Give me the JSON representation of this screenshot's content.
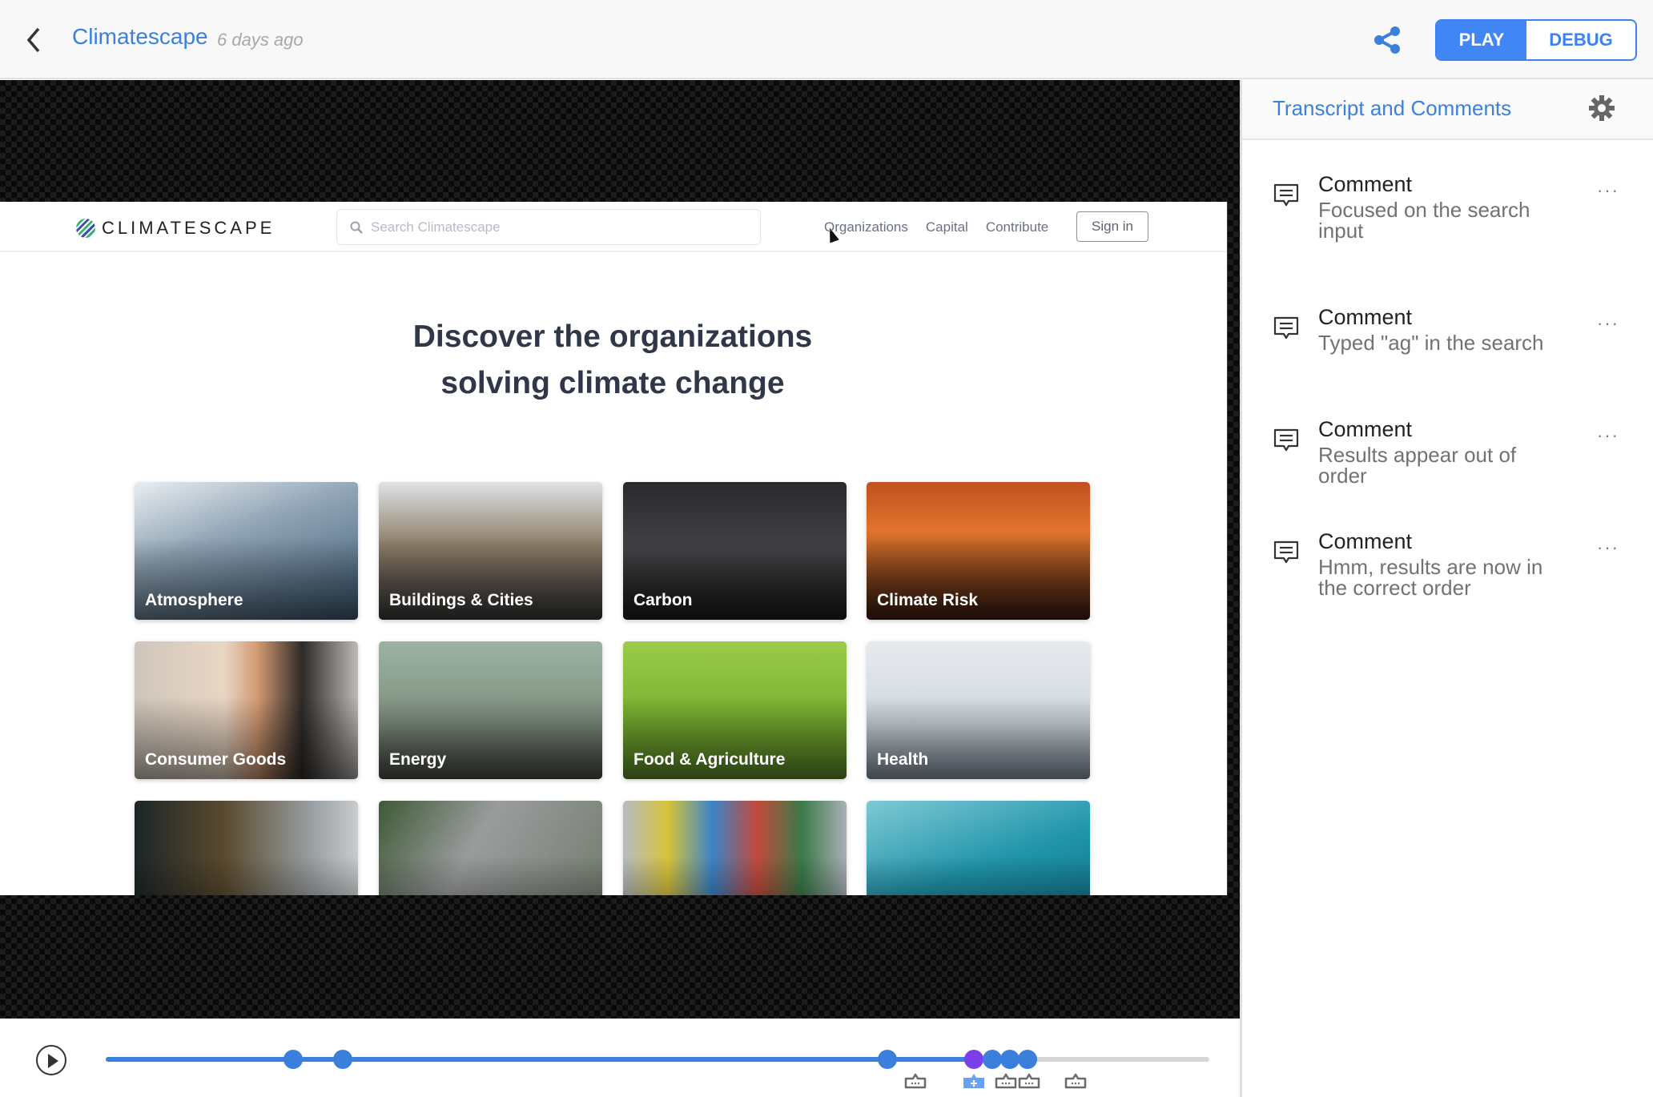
{
  "header": {
    "title": "Climatescape",
    "timestamp": "6 days ago",
    "modes": {
      "play": "PLAY",
      "debug": "DEBUG",
      "active": "PLAY"
    },
    "accent_color": "#3b80dd"
  },
  "site": {
    "logo_text": "CLIMATESCAPE",
    "search_placeholder": "Search Climatescape",
    "nav_links": [
      "Organizations",
      "Capital",
      "Contribute"
    ],
    "signin_label": "Sign in",
    "hero_line1": "Discover the organizations",
    "hero_line2": "solving climate change",
    "tiles": [
      {
        "label": "Atmosphere"
      },
      {
        "label": "Buildings & Cities"
      },
      {
        "label": "Carbon"
      },
      {
        "label": "Climate Risk"
      },
      {
        "label": "Consumer Goods"
      },
      {
        "label": "Energy"
      },
      {
        "label": "Food & Agriculture"
      },
      {
        "label": "Health"
      },
      {
        "label": ""
      },
      {
        "label": ""
      },
      {
        "label": ""
      },
      {
        "label": ""
      }
    ]
  },
  "panel": {
    "title": "Transcript and Comments",
    "comments": [
      {
        "title": "Comment",
        "text": "Focused on the search input"
      },
      {
        "title": "Comment",
        "text": "Typed \"ag\" in the search"
      },
      {
        "title": "Comment",
        "text": "Results appear out of order"
      },
      {
        "title": "Comment",
        "text": "Hmm, results are now in the correct order"
      }
    ],
    "more_label": "···"
  },
  "timeline": {
    "progress": 0.833,
    "events": [
      {
        "pos": 0.17,
        "type": "event"
      },
      {
        "pos": 0.215,
        "type": "event"
      },
      {
        "pos": 0.708,
        "type": "event"
      },
      {
        "pos": 0.787,
        "type": "current"
      },
      {
        "pos": 0.803,
        "type": "event"
      },
      {
        "pos": 0.819,
        "type": "event"
      },
      {
        "pos": 0.835,
        "type": "event"
      }
    ],
    "markers": [
      {
        "pos": 0.734,
        "type": "comment"
      },
      {
        "pos": 0.787,
        "type": "add-comment"
      },
      {
        "pos": 0.816,
        "type": "comment"
      },
      {
        "pos": 0.837,
        "type": "comment"
      },
      {
        "pos": 0.879,
        "type": "comment"
      }
    ]
  }
}
